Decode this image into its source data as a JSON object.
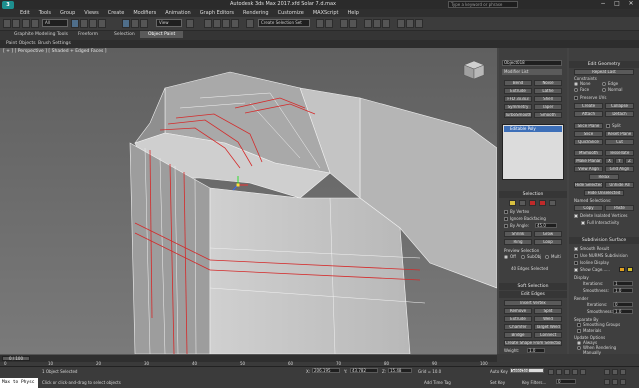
{
  "app": {
    "title": "Autodesk 3ds Max 2017.xfd  Solar 7.d.max",
    "search_placeholder": "Type a keyword or phrase",
    "logo": "3",
    "window_controls": [
      "−",
      "□",
      "✕"
    ]
  },
  "menu": [
    "Edit",
    "Tools",
    "Group",
    "Views",
    "Create",
    "Modifiers",
    "Animation",
    "Graph Editors",
    "Rendering",
    "Customize",
    "MAXScript",
    "Help"
  ],
  "toolbar": {
    "selection_filter": "All",
    "reference_coord": "View",
    "named_selection": "Create Selection Set"
  },
  "ribbon_tabs": [
    "Graphite Modeling Tools",
    "Freeform",
    "Selection",
    "Object Paint"
  ],
  "ribbon_active_tab": "Object Paint",
  "subtabs": [
    "Paint Objects",
    "Brush Settings"
  ],
  "viewport": {
    "label": "[ + ] [ Perspective ] [ Shaded + Edged Faces ]"
  },
  "command_panel": {
    "object_name": "Object018",
    "modifier_list": "Modifier List",
    "modifier_buttons": [
      "Bend",
      "Noise",
      "Extrude",
      "Lathe",
      "FFD 3x3x3",
      "Shell",
      "Symmetry",
      "Taper",
      "TurboSmooth",
      "Smooth"
    ],
    "stack_item": "Editable Poly",
    "selection": {
      "header": "Selection",
      "by_vertex": "By Vertex",
      "ignore_backfacing": "Ignore Backfacing",
      "by_angle": "By Angle:",
      "angle_value": "45.0",
      "shrink": "Shrink",
      "grow": "Grow",
      "ring": "Ring",
      "loop": "Loop",
      "preview_selection": "Preview Selection",
      "preview_off": "Off",
      "preview_subobj": "SubObj",
      "preview_multi": "Multi",
      "selected_count": "40 Edges Selected"
    },
    "soft_selection": "Soft Selection",
    "edit_edges": {
      "header": "Edit Edges",
      "insert_vertex": "Insert Vertex",
      "remove": "Remove",
      "split": "Split",
      "extrude": "Extrude",
      "weld": "Weld",
      "chamfer": "Chamfer",
      "target_weld": "Target Weld",
      "bridge": "Bridge",
      "connect": "Connect",
      "create_shape": "Create Shape From Selection",
      "weight_label": "Weight:",
      "weight_value": "1.0",
      "crease_label": "Crease:",
      "crease_value": "0.0"
    }
  },
  "edit_geometry": {
    "header": "Edit Geometry",
    "repeat_last": "Repeat Last",
    "constraints": "Constraints",
    "none": "None",
    "edge": "Edge",
    "face": "Face",
    "normal": "Normal",
    "preserve_uvs": "Preserve UVs",
    "create": "Create",
    "collapse": "Collapse",
    "attach": "Attach",
    "detach": "Detach",
    "slice_plane": "Slice Plane",
    "split": "Split",
    "slice": "Slice",
    "reset_plane": "Reset Plane",
    "quickslice": "QuickSlice",
    "cut": "Cut",
    "msmooth": "MSmooth",
    "tessellate": "Tessellate",
    "make_planar": "Make Planar",
    "x": "X",
    "y": "Y",
    "z": "Z",
    "view_align": "View Align",
    "grid_align": "Grid Align",
    "relax": "Relax",
    "hide_selected": "Hide Selected",
    "unhide_all": "Unhide All",
    "hide_unselected": "Hide Unselected",
    "named_selections": "Named Selections:",
    "copy": "Copy",
    "paste": "Paste",
    "delete_isolated": "Delete Isolated Vertices",
    "full_interactivity": "Full Interactivity"
  },
  "subdivision": {
    "header": "Subdivision Surface",
    "smooth_result": "Smooth Result",
    "use_nurms": "Use NURMS Subdivision",
    "isoline": "Isoline Display",
    "show_cage": "Show Cage......",
    "display": "Display",
    "iterations_label": "Iterations:",
    "iterations_value": "1",
    "smoothness_label": "Smoothness:",
    "smoothness_value": "1.0",
    "render": "Render",
    "r_iterations_value": "0",
    "r_smoothness_value": "1.0",
    "separate_by": "Separate By",
    "smoothing_groups": "Smoothing Groups",
    "materials": "Materials",
    "update_options": "Update Options",
    "always": "Always",
    "when_rendering": "When Rendering",
    "manually": "Manually"
  },
  "timeline": {
    "frame_counter": "0 / 100",
    "ticks": [
      "0",
      "10",
      "20",
      "30",
      "40",
      "50",
      "60",
      "70",
      "80",
      "90",
      "100"
    ]
  },
  "status": {
    "selected": "1 Object Selected",
    "hint": "Click or click-and-drag to select objects",
    "x_label": "X:",
    "x_value": "206.195",
    "y_label": "Y:",
    "y_value": "43.782",
    "z_label": "Z:",
    "z_value": "15.48",
    "grid": "Grid = 10.0",
    "add_time_tag": "Add Time Tag",
    "auto_key": "Auto Key",
    "key_mode": "Selected",
    "set_key": "Set Key",
    "key_filters": "Key Filters...",
    "frame": "0",
    "script_pill": "Max to Physc"
  }
}
